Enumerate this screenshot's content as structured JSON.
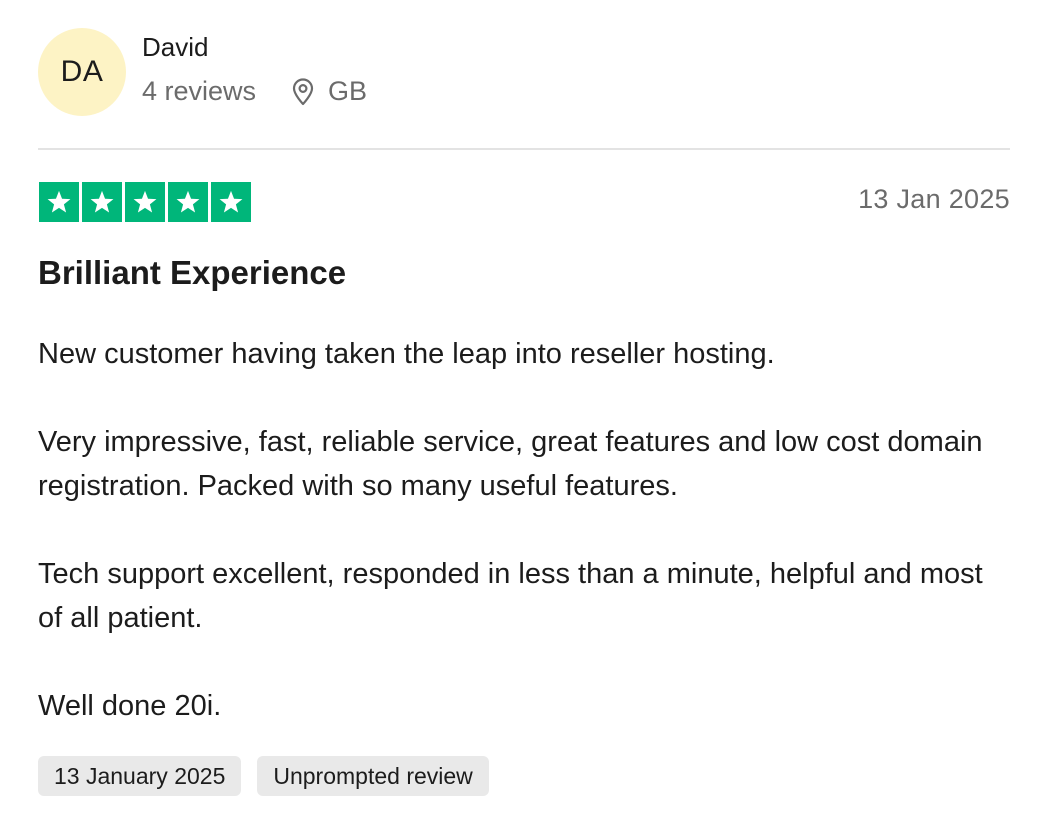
{
  "reviewer": {
    "initials": "DA",
    "name": "David",
    "review_count": "4 reviews",
    "country": "GB",
    "avatar_color": "#fdf3c5"
  },
  "review": {
    "rating": 5,
    "max_rating": 5,
    "star_color": "#00b67a",
    "date": "13 Jan 2025",
    "title": "Brilliant Experience",
    "paragraphs": [
      "New customer having taken the leap into reseller hosting.",
      "Very impressive, fast, reliable service, great features and low cost domain registration. Packed with so many useful features.",
      "Tech support excellent, responded in less than a minute, helpful and most of all patient.",
      "Well done 20i."
    ],
    "tags": {
      "experience_date": "13 January 2025",
      "review_type": "Unprompted review"
    }
  },
  "icons": {
    "location": "location-pin-icon",
    "star": "star-icon"
  }
}
